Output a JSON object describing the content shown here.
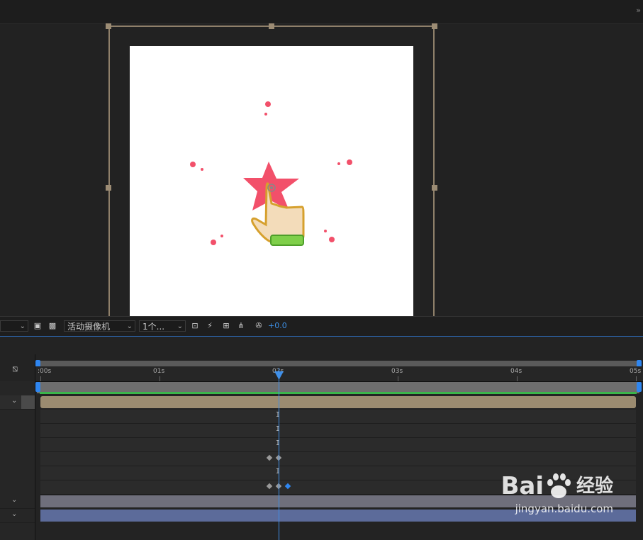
{
  "toolbar": {
    "camera_label": "活动摄像机",
    "views_label": "1个...",
    "exposure_value": "+0.0"
  },
  "timeline": {
    "ruler_labels": [
      ":00s",
      "01s",
      "02s",
      "03s",
      "04s",
      "05s"
    ]
  },
  "watermark": {
    "brand_left": "Bai",
    "brand_right": "经验",
    "url": "jingyan.baidu.com"
  },
  "colors": {
    "accent": "#3d8fe5",
    "star": "#f2506a",
    "layer_bar": "#9b8b70"
  }
}
